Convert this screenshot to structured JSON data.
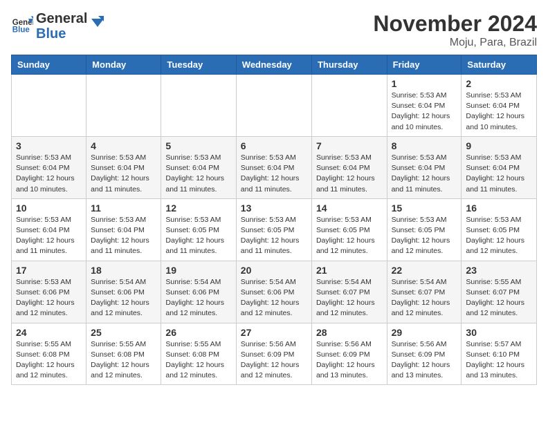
{
  "app": {
    "logo_general": "General",
    "logo_blue": "Blue",
    "month": "November 2024",
    "location": "Moju, Para, Brazil"
  },
  "weekdays": [
    "Sunday",
    "Monday",
    "Tuesday",
    "Wednesday",
    "Thursday",
    "Friday",
    "Saturday"
  ],
  "rows": [
    [
      {
        "day": "",
        "info": ""
      },
      {
        "day": "",
        "info": ""
      },
      {
        "day": "",
        "info": ""
      },
      {
        "day": "",
        "info": ""
      },
      {
        "day": "",
        "info": ""
      },
      {
        "day": "1",
        "info": "Sunrise: 5:53 AM\nSunset: 6:04 PM\nDaylight: 12 hours\nand 10 minutes."
      },
      {
        "day": "2",
        "info": "Sunrise: 5:53 AM\nSunset: 6:04 PM\nDaylight: 12 hours\nand 10 minutes."
      }
    ],
    [
      {
        "day": "3",
        "info": "Sunrise: 5:53 AM\nSunset: 6:04 PM\nDaylight: 12 hours\nand 10 minutes."
      },
      {
        "day": "4",
        "info": "Sunrise: 5:53 AM\nSunset: 6:04 PM\nDaylight: 12 hours\nand 11 minutes."
      },
      {
        "day": "5",
        "info": "Sunrise: 5:53 AM\nSunset: 6:04 PM\nDaylight: 12 hours\nand 11 minutes."
      },
      {
        "day": "6",
        "info": "Sunrise: 5:53 AM\nSunset: 6:04 PM\nDaylight: 12 hours\nand 11 minutes."
      },
      {
        "day": "7",
        "info": "Sunrise: 5:53 AM\nSunset: 6:04 PM\nDaylight: 12 hours\nand 11 minutes."
      },
      {
        "day": "8",
        "info": "Sunrise: 5:53 AM\nSunset: 6:04 PM\nDaylight: 12 hours\nand 11 minutes."
      },
      {
        "day": "9",
        "info": "Sunrise: 5:53 AM\nSunset: 6:04 PM\nDaylight: 12 hours\nand 11 minutes."
      }
    ],
    [
      {
        "day": "10",
        "info": "Sunrise: 5:53 AM\nSunset: 6:04 PM\nDaylight: 12 hours\nand 11 minutes."
      },
      {
        "day": "11",
        "info": "Sunrise: 5:53 AM\nSunset: 6:04 PM\nDaylight: 12 hours\nand 11 minutes."
      },
      {
        "day": "12",
        "info": "Sunrise: 5:53 AM\nSunset: 6:05 PM\nDaylight: 12 hours\nand 11 minutes."
      },
      {
        "day": "13",
        "info": "Sunrise: 5:53 AM\nSunset: 6:05 PM\nDaylight: 12 hours\nand 11 minutes."
      },
      {
        "day": "14",
        "info": "Sunrise: 5:53 AM\nSunset: 6:05 PM\nDaylight: 12 hours\nand 12 minutes."
      },
      {
        "day": "15",
        "info": "Sunrise: 5:53 AM\nSunset: 6:05 PM\nDaylight: 12 hours\nand 12 minutes."
      },
      {
        "day": "16",
        "info": "Sunrise: 5:53 AM\nSunset: 6:05 PM\nDaylight: 12 hours\nand 12 minutes."
      }
    ],
    [
      {
        "day": "17",
        "info": "Sunrise: 5:53 AM\nSunset: 6:06 PM\nDaylight: 12 hours\nand 12 minutes."
      },
      {
        "day": "18",
        "info": "Sunrise: 5:54 AM\nSunset: 6:06 PM\nDaylight: 12 hours\nand 12 minutes."
      },
      {
        "day": "19",
        "info": "Sunrise: 5:54 AM\nSunset: 6:06 PM\nDaylight: 12 hours\nand 12 minutes."
      },
      {
        "day": "20",
        "info": "Sunrise: 5:54 AM\nSunset: 6:06 PM\nDaylight: 12 hours\nand 12 minutes."
      },
      {
        "day": "21",
        "info": "Sunrise: 5:54 AM\nSunset: 6:07 PM\nDaylight: 12 hours\nand 12 minutes."
      },
      {
        "day": "22",
        "info": "Sunrise: 5:54 AM\nSunset: 6:07 PM\nDaylight: 12 hours\nand 12 minutes."
      },
      {
        "day": "23",
        "info": "Sunrise: 5:55 AM\nSunset: 6:07 PM\nDaylight: 12 hours\nand 12 minutes."
      }
    ],
    [
      {
        "day": "24",
        "info": "Sunrise: 5:55 AM\nSunset: 6:08 PM\nDaylight: 12 hours\nand 12 minutes."
      },
      {
        "day": "25",
        "info": "Sunrise: 5:55 AM\nSunset: 6:08 PM\nDaylight: 12 hours\nand 12 minutes."
      },
      {
        "day": "26",
        "info": "Sunrise: 5:55 AM\nSunset: 6:08 PM\nDaylight: 12 hours\nand 12 minutes."
      },
      {
        "day": "27",
        "info": "Sunrise: 5:56 AM\nSunset: 6:09 PM\nDaylight: 12 hours\nand 12 minutes."
      },
      {
        "day": "28",
        "info": "Sunrise: 5:56 AM\nSunset: 6:09 PM\nDaylight: 12 hours\nand 13 minutes."
      },
      {
        "day": "29",
        "info": "Sunrise: 5:56 AM\nSunset: 6:09 PM\nDaylight: 12 hours\nand 13 minutes."
      },
      {
        "day": "30",
        "info": "Sunrise: 5:57 AM\nSunset: 6:10 PM\nDaylight: 12 hours\nand 13 minutes."
      }
    ]
  ]
}
